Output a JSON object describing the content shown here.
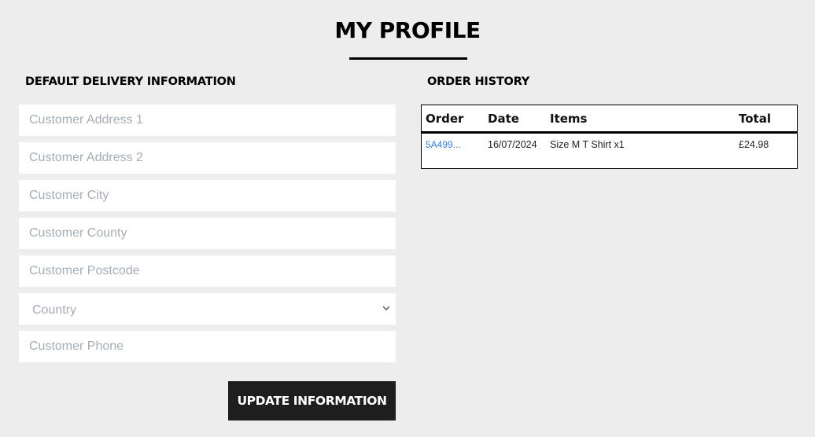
{
  "page": {
    "title": "MY PROFILE"
  },
  "delivery": {
    "heading": "DEFAULT DELIVERY INFORMATION",
    "fields": {
      "address1_placeholder": "Customer Address 1",
      "address2_placeholder": "Customer Address 2",
      "city_placeholder": "Customer City",
      "county_placeholder": "Customer County",
      "postcode_placeholder": "Customer Postcode",
      "country_selected": "Country",
      "phone_placeholder": "Customer Phone"
    },
    "update_label": "UPDATE INFORMATION"
  },
  "orders": {
    "heading": "ORDER HISTORY",
    "columns": [
      "Order",
      "Date",
      "Items",
      "Total"
    ],
    "rows": [
      {
        "order": "5A499...",
        "date": "16/07/2024",
        "items": "Size M T Shirt x1",
        "total": "£24.98"
      }
    ]
  },
  "colors": {
    "background": "#ededed",
    "button": "#1e1e1e",
    "link": "#3a7bd5",
    "placeholder": "#a6adb5"
  }
}
